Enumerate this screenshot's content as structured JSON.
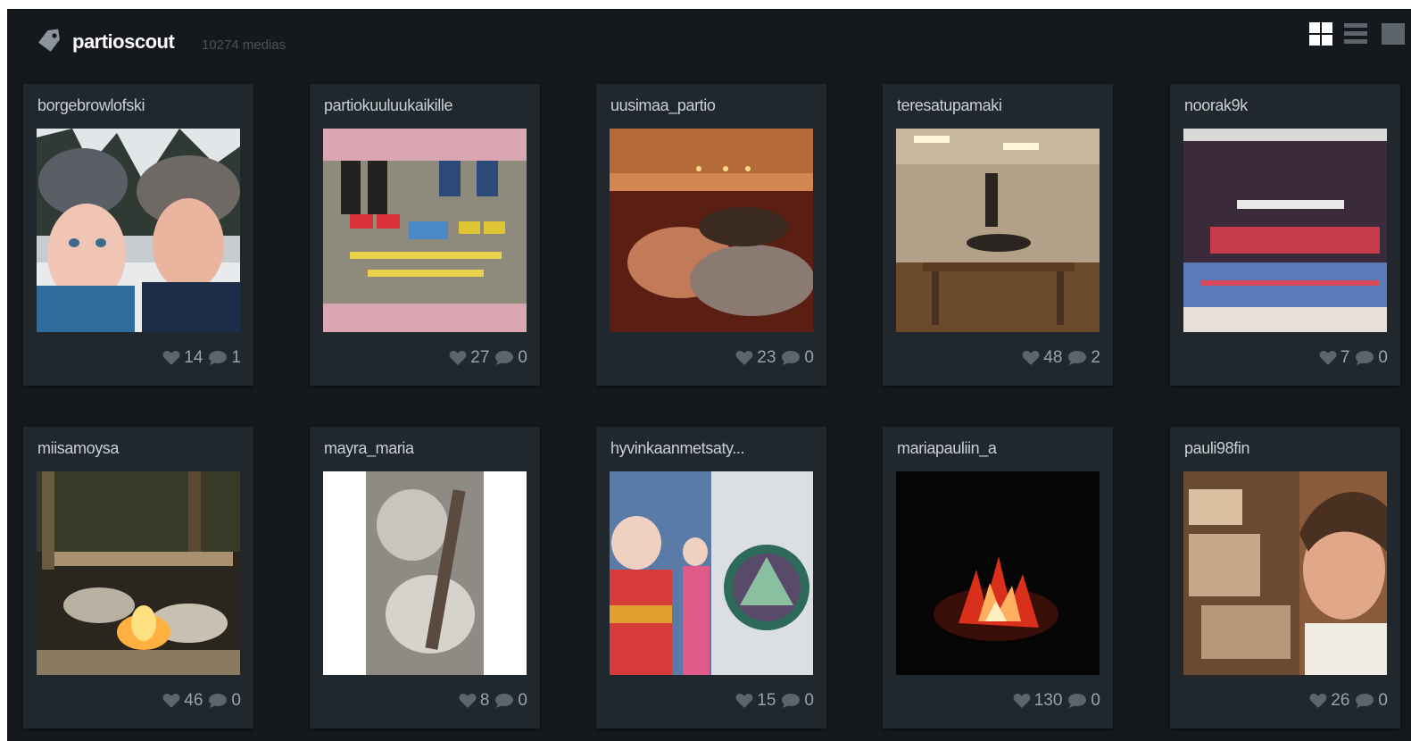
{
  "header": {
    "title": "partioscout",
    "count": "10274 medias",
    "icon": "tag-icon"
  },
  "view_modes": [
    "grid-view-icon",
    "list-view-icon",
    "extra-view-icon"
  ],
  "cards": [
    {
      "username": "borgebrowlofski",
      "likes": "14",
      "comments": "1"
    },
    {
      "username": "partiokuuluukaikille",
      "likes": "27",
      "comments": "0"
    },
    {
      "username": "uusimaa_partio",
      "likes": "23",
      "comments": "0"
    },
    {
      "username": "teresatupamaki",
      "likes": "48",
      "comments": "2"
    },
    {
      "username": "noorak9k",
      "likes": "7",
      "comments": "0"
    },
    {
      "username": "miisamoysa",
      "likes": "46",
      "comments": "0"
    },
    {
      "username": "mayra_maria",
      "likes": "8",
      "comments": "0"
    },
    {
      "username": "hyvinkaanmetsaty...",
      "likes": "15",
      "comments": "0"
    },
    {
      "username": "mariapauliin_a",
      "likes": "130",
      "comments": "0"
    },
    {
      "username": "pauli98fin",
      "likes": "26",
      "comments": "0"
    }
  ],
  "colors": {
    "background": "#15191d",
    "card": "#20272d",
    "text": "#c9d0d5",
    "muted": "#9aa3a9"
  }
}
